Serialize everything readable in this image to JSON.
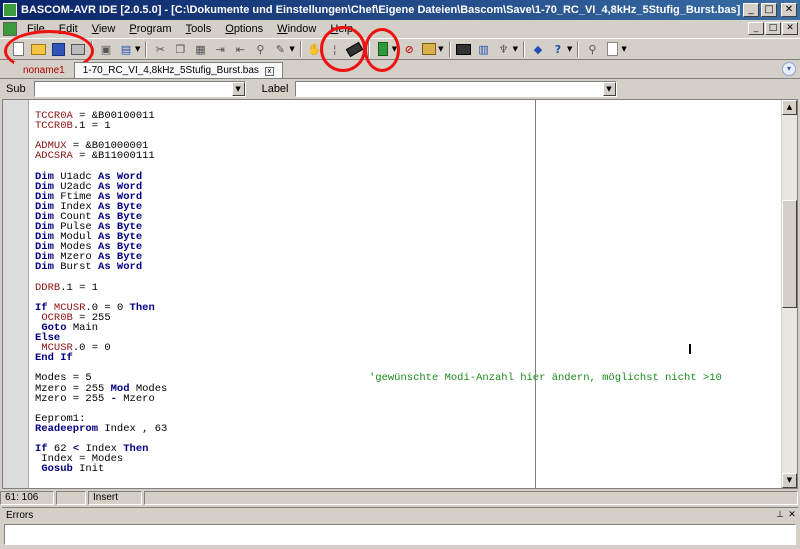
{
  "window": {
    "title": "BASCOM-AVR IDE [2.0.5.0] - [C:\\Dokumente und Einstellungen\\Chef\\Eigene Dateien\\Bascom\\Save\\1-70_RC_VI_4,8kHz_5Stufig_Burst.bas]",
    "min": "_",
    "max": "□",
    "close": "✕"
  },
  "menu": {
    "items": [
      "File",
      "Edit",
      "View",
      "Program",
      "Tools",
      "Options",
      "Window",
      "Help"
    ]
  },
  "tabs": {
    "items": [
      {
        "label": "noname1",
        "active": false
      },
      {
        "label": "1-70_RC_VI_4,8kHz_5Stufig_Burst.bas",
        "active": true
      }
    ],
    "close_glyph": "x",
    "scroll_glyph": "▾"
  },
  "subbar": {
    "sub_label": "Sub",
    "label_label": "Label",
    "sub_value": "",
    "label_value": ""
  },
  "editor": {
    "lines": [
      [
        [
          "reg",
          "TCCR0A"
        ],
        [
          "num",
          " = &B00100011"
        ]
      ],
      [
        [
          "reg",
          "TCCR0B"
        ],
        [
          "num",
          ".1 = 1"
        ]
      ],
      [],
      [
        [
          "reg",
          "ADMUX"
        ],
        [
          "num",
          " = &B01000001"
        ]
      ],
      [
        [
          "reg",
          "ADCSRA"
        ],
        [
          "num",
          " = &B11000111"
        ]
      ],
      [],
      [
        [
          "kw",
          "Dim"
        ],
        [
          "num",
          " U1adc "
        ],
        [
          "kw",
          "As Word"
        ]
      ],
      [
        [
          "kw",
          "Dim"
        ],
        [
          "num",
          " U2adc "
        ],
        [
          "kw",
          "As Word"
        ]
      ],
      [
        [
          "kw",
          "Dim"
        ],
        [
          "num",
          " Ftime "
        ],
        [
          "kw",
          "As Word"
        ]
      ],
      [
        [
          "kw",
          "Dim"
        ],
        [
          "num",
          " Index "
        ],
        [
          "kw",
          "As Byte"
        ]
      ],
      [
        [
          "kw",
          "Dim"
        ],
        [
          "num",
          " Count "
        ],
        [
          "kw",
          "As Byte"
        ]
      ],
      [
        [
          "kw",
          "Dim"
        ],
        [
          "num",
          " Pulse "
        ],
        [
          "kw",
          "As Byte"
        ]
      ],
      [
        [
          "kw",
          "Dim"
        ],
        [
          "num",
          " Modul "
        ],
        [
          "kw",
          "As Byte"
        ]
      ],
      [
        [
          "kw",
          "Dim"
        ],
        [
          "num",
          " Modes "
        ],
        [
          "kw",
          "As Byte"
        ]
      ],
      [
        [
          "kw",
          "Dim"
        ],
        [
          "num",
          " Mzero "
        ],
        [
          "kw",
          "As Byte"
        ]
      ],
      [
        [
          "kw",
          "Dim"
        ],
        [
          "num",
          " Burst "
        ],
        [
          "kw",
          "As Word"
        ]
      ],
      [],
      [
        [
          "reg",
          "DDRB"
        ],
        [
          "num",
          ".1 = 1"
        ]
      ],
      [],
      [
        [
          "kw",
          "If"
        ],
        [
          "num",
          " "
        ],
        [
          "reg",
          "MCUSR"
        ],
        [
          "num",
          ".0 = 0 "
        ],
        [
          "kw",
          "Then"
        ]
      ],
      [
        [
          "num",
          " "
        ],
        [
          "reg",
          "OCR0B"
        ],
        [
          "num",
          " = 255"
        ]
      ],
      [
        [
          "num",
          " "
        ],
        [
          "kw",
          "Goto"
        ],
        [
          "num",
          " Main"
        ]
      ],
      [
        [
          "kw",
          "Else"
        ]
      ],
      [
        [
          "num",
          " "
        ],
        [
          "reg",
          "MCUSR"
        ],
        [
          "num",
          ".0 = 0"
        ]
      ],
      [
        [
          "kw",
          "End If"
        ]
      ],
      [],
      [
        [
          "num",
          "Modes = 5                                            "
        ],
        [
          "cm",
          "'gewünschte Modi-Anzahl hier ändern, möglichst nicht >10"
        ]
      ],
      [
        [
          "num",
          "Mzero = 255 "
        ],
        [
          "kw",
          "Mod"
        ],
        [
          "num",
          " Modes"
        ]
      ],
      [
        [
          "num",
          "Mzero = 255 "
        ],
        [
          "kw",
          "-"
        ],
        [
          "num",
          " Mzero"
        ]
      ],
      [],
      [
        [
          "num",
          "Eeprom1:"
        ]
      ],
      [
        [
          "kw",
          "Readeeprom"
        ],
        [
          "num",
          " Index , 63"
        ]
      ],
      [],
      [
        [
          "kw",
          "If"
        ],
        [
          "num",
          " 62 "
        ],
        [
          "kw",
          "<"
        ],
        [
          "num",
          " Index "
        ],
        [
          "kw",
          "Then"
        ]
      ],
      [
        [
          "num",
          " Index = Modes"
        ]
      ],
      [
        [
          "num",
          " "
        ],
        [
          "kw",
          "Gosub"
        ],
        [
          "num",
          " Init"
        ]
      ]
    ]
  },
  "status": {
    "position": "61: 106",
    "modified": "",
    "mode": "Insert"
  },
  "errors": {
    "title": "Errors",
    "pin": "⊥",
    "close": "✕"
  },
  "colors": {
    "keyword": "#000080",
    "register": "#8b1010",
    "comment": "#1b8a1b",
    "annotation": "#ee1111"
  }
}
